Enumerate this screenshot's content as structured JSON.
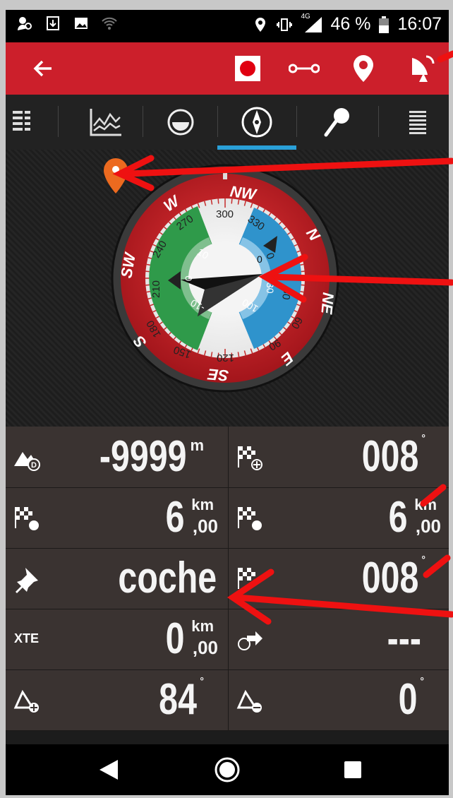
{
  "status_bar": {
    "network": "4G",
    "battery": "46 %",
    "time": "16:07"
  },
  "toolbar": {
    "icons": [
      "back-arrow-icon",
      "record-icon",
      "track-icon",
      "waypoint-icon",
      "gps-satellite-icon"
    ],
    "accent_color": "#cc1f2b"
  },
  "tabs": {
    "items": [
      "list-icon",
      "chart-icon",
      "level-icon",
      "compass-icon",
      "search-icon",
      "menu-icon"
    ],
    "active_index": 3,
    "active_color": "#2aa0d8"
  },
  "compass": {
    "cardinals": [
      "NW",
      "N",
      "NE",
      "E",
      "SE",
      "S",
      "SW",
      "W"
    ],
    "degree_labels": [
      "300",
      "330",
      "0",
      "30",
      "60",
      "90",
      "120",
      "150",
      "180",
      "210",
      "240",
      "270"
    ],
    "inclinometer_left": [
      "10",
      "0",
      "-10"
    ],
    "inclinometer_right": [
      "0",
      "30",
      "100"
    ]
  },
  "data_grid": {
    "rows": [
      {
        "left": {
          "icon": "altitude-icon",
          "value": "-9999",
          "unit": "m"
        },
        "right": {
          "icon": "flag-bearing-icon",
          "value": "008",
          "unit": "°"
        }
      },
      {
        "left": {
          "icon": "flag-distance-icon",
          "value": "6",
          "unit": "km",
          "decimal": ",00"
        },
        "right": {
          "icon": "flag-distance-icon",
          "value": "6",
          "unit": "km",
          "decimal": ",00"
        }
      },
      {
        "left": {
          "icon": "pin-icon",
          "value": "coche"
        },
        "right": {
          "icon": "flag-heading-icon",
          "value": "008",
          "unit": "°"
        }
      },
      {
        "left": {
          "label": "XTE",
          "value": "0",
          "unit": "km",
          "decimal": ",00"
        },
        "right": {
          "icon": "turn-arrow-icon",
          "value": "---"
        }
      },
      {
        "left": {
          "icon": "slope-up-icon",
          "value": "84",
          "unit": "°"
        },
        "right": {
          "icon": "slope-down-icon",
          "value": "0",
          "unit": "°"
        }
      }
    ]
  },
  "nav_bar": {
    "icons": [
      "back-triangle-icon",
      "home-circle-icon",
      "recents-square-icon"
    ]
  }
}
